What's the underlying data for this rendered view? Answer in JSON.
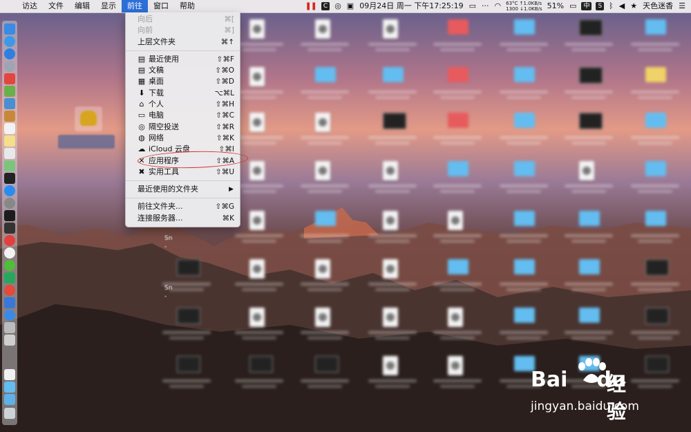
{
  "menubar": {
    "apple": "",
    "items": [
      "访达",
      "文件",
      "编辑",
      "显示",
      "前往",
      "窗口",
      "帮助"
    ],
    "active_index": 4,
    "status": {
      "temp": "63°C",
      "fan": "1300",
      "up_speed": "↑1.0KB/s",
      "down_speed": "↓1.0KB/s",
      "datetime": "09月24日 周一 下午17:25:19",
      "battery": "51%",
      "input_method": "中",
      "s_badge": "S",
      "app_name": "天色迷香",
      "c_badge": "C"
    }
  },
  "go_menu": {
    "items": [
      {
        "label": "向后",
        "shortcut": "⌘[",
        "disabled": true,
        "icon": ""
      },
      {
        "label": "向前",
        "shortcut": "⌘]",
        "disabled": true,
        "icon": ""
      },
      {
        "label": "上层文件夹",
        "shortcut": "⌘↑",
        "disabled": false,
        "icon": ""
      },
      {
        "separator": true
      },
      {
        "label": "最近使用",
        "shortcut": "⇧⌘F",
        "icon": "recents-icon"
      },
      {
        "label": "文稿",
        "shortcut": "⇧⌘O",
        "icon": "documents-icon"
      },
      {
        "label": "桌面",
        "shortcut": "⇧⌘D",
        "icon": "desktop-icon"
      },
      {
        "label": "下载",
        "shortcut": "⌥⌘L",
        "icon": "downloads-icon"
      },
      {
        "label": "个人",
        "shortcut": "⇧⌘H",
        "icon": "home-icon"
      },
      {
        "label": "电脑",
        "shortcut": "⇧⌘C",
        "icon": "computer-icon"
      },
      {
        "label": "隔空投送",
        "shortcut": "⇧⌘R",
        "icon": "airdrop-icon"
      },
      {
        "label": "网络",
        "shortcut": "⇧⌘K",
        "icon": "network-icon"
      },
      {
        "label": "iCloud 云盘",
        "shortcut": "⇧⌘I",
        "icon": "icloud-icon"
      },
      {
        "label": "应用程序",
        "shortcut": "⇧⌘A",
        "icon": "applications-icon",
        "highlighted": true
      },
      {
        "label": "实用工具",
        "shortcut": "⇧⌘U",
        "icon": "utilities-icon"
      },
      {
        "separator": true
      },
      {
        "label": "最近使用的文件夹",
        "submenu": true
      },
      {
        "separator": true
      },
      {
        "label": "前往文件夹...",
        "shortcut": "⇧⌘G"
      },
      {
        "label": "连接服务器...",
        "shortcut": "⌘K"
      }
    ]
  },
  "desktop": {
    "side_labels": [
      "Sn",
      "-",
      "Sn",
      "-"
    ]
  },
  "watermark": {
    "brand": "Bai",
    "brand2": "du",
    "chinese": "经验",
    "url": "jingyan.baidu.com"
  }
}
